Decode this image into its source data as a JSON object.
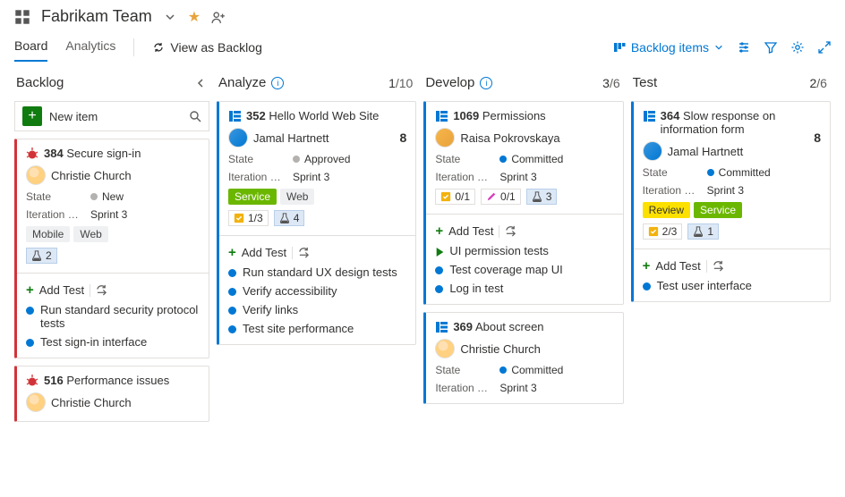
{
  "header": {
    "project": "Fabrikam Team"
  },
  "tabs": {
    "board": "Board",
    "analytics": "Analytics",
    "view_as": "View as Backlog"
  },
  "toolbar": {
    "backlog_items": "Backlog items"
  },
  "columns": {
    "backlog": {
      "title": "Backlog",
      "new_item": "New item"
    },
    "analyze": {
      "title": "Analyze",
      "count": "1",
      "cap": "/10"
    },
    "develop": {
      "title": "Develop",
      "count": "3",
      "cap": "/6"
    },
    "test": {
      "title": "Test",
      "count": "2",
      "cap": "/6"
    }
  },
  "labels": {
    "state": "State",
    "iter": "Iteration P...",
    "add_test": "Add Test"
  },
  "cards": {
    "c384": {
      "id": "384",
      "title": "Secure sign-in",
      "assignee": "Christie Church",
      "state": "New",
      "iter": "Sprint 3",
      "tags": [
        "Mobile",
        "Web"
      ],
      "flask": "2",
      "tests": [
        "Run standard security protocol tests",
        "Test sign-in interface"
      ]
    },
    "c516": {
      "id": "516",
      "title": "Performance issues",
      "assignee": "Christie Church"
    },
    "c352": {
      "id": "352",
      "title": "Hello World Web Site",
      "assignee": "Jamal Hartnett",
      "effort": "8",
      "state": "Approved",
      "iter": "Sprint 3",
      "tags": [
        "Service",
        "Web"
      ],
      "task": "1/3",
      "flask": "4",
      "tests": [
        "Run standard UX design tests",
        "Verify accessibility",
        "Verify links",
        "Test site performance"
      ]
    },
    "c1069": {
      "id": "1069",
      "title": "Permissions",
      "assignee": "Raisa Pokrovskaya",
      "state": "Committed",
      "iter": "Sprint 3",
      "task": "0/1",
      "bug": "0/1",
      "flask": "3",
      "tests": [
        "UI permission tests",
        "Test coverage map UI",
        "Log in test"
      ]
    },
    "c369": {
      "id": "369",
      "title": "About screen",
      "assignee": "Christie Church",
      "state": "Committed",
      "iter": "Sprint 3"
    },
    "c364": {
      "id": "364",
      "title": "Slow response on information form",
      "assignee": "Jamal Hartnett",
      "effort": "8",
      "state": "Committed",
      "iter": "Sprint 3",
      "tags": [
        "Review",
        "Service"
      ],
      "task": "2/3",
      "flask": "1",
      "tests": [
        "Test user interface"
      ]
    }
  }
}
